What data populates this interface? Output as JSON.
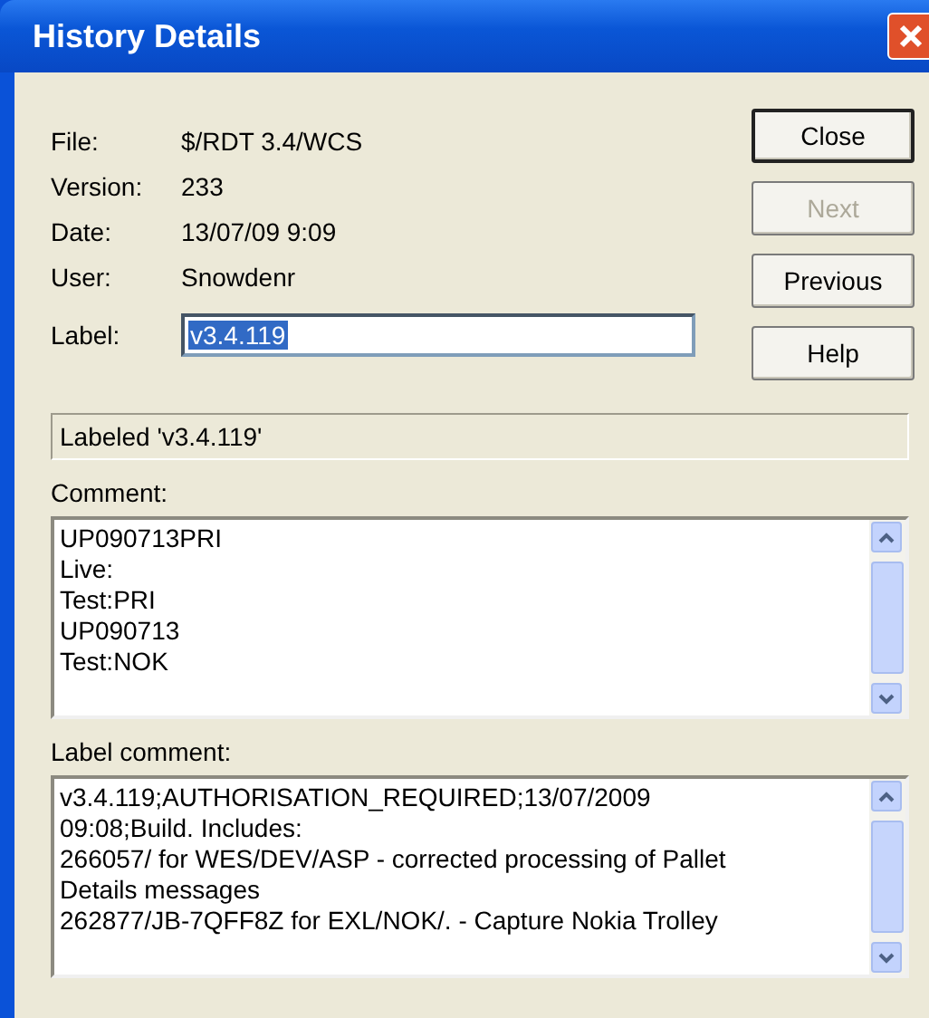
{
  "window": {
    "title": "History Details"
  },
  "fields": [
    {
      "label": "File:",
      "value": "$/RDT 3.4/WCS"
    },
    {
      "label": "Version:",
      "value": "233"
    },
    {
      "label": "Date:",
      "value": "13/07/09   9:09"
    },
    {
      "label": "User:",
      "value": "Snowdenr"
    }
  ],
  "label_field": {
    "label": "Label:",
    "value": "v3.4.119",
    "selected": true
  },
  "buttons": [
    {
      "label": "Close",
      "default": true,
      "disabled": false
    },
    {
      "label": "Next",
      "default": false,
      "disabled": true
    },
    {
      "label": "Previous",
      "default": false,
      "disabled": false
    },
    {
      "label": "Help",
      "default": false,
      "disabled": false
    }
  ],
  "status": "Labeled 'v3.4.119'",
  "comment": {
    "label": "Comment:",
    "lines": [
      "UP090713PRI",
      "Live:",
      "Test:PRI",
      "UP090713",
      "Test:NOK"
    ]
  },
  "label_comment": {
    "label": "Label comment:",
    "lines": [
      "v3.4.119;AUTHORISATION_REQUIRED;13/07/2009",
      "09:08;Build. Includes:",
      "266057/ for WES/DEV/ASP - corrected processing of Pallet",
      "Details messages",
      "262877/JB-7QFF8Z for EXL/NOK/. - Capture Nokia Trolley"
    ]
  }
}
